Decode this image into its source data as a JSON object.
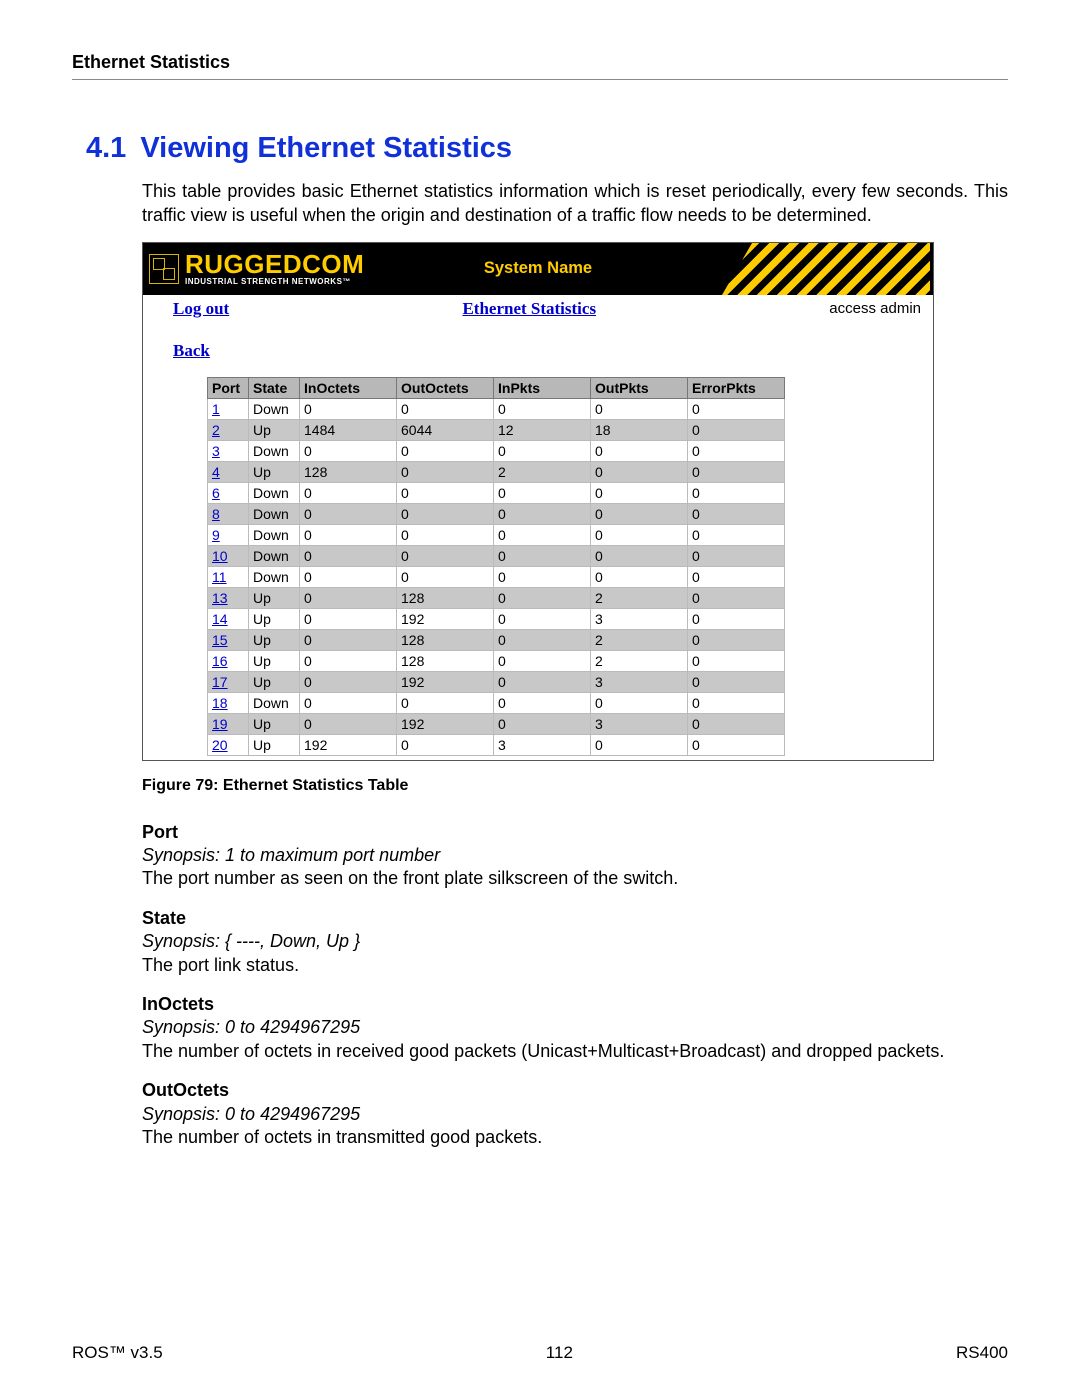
{
  "header": {
    "title": "Ethernet Statistics"
  },
  "section": {
    "number": "4.1",
    "title": "Viewing Ethernet Statistics",
    "paragraph": "This table provides basic Ethernet statistics information which is reset periodically, every few seconds. This traffic view is useful when the origin and destination of a traffic flow needs to be determined."
  },
  "screenshot": {
    "brand": "RUGGEDCOM",
    "brand_sub": "INDUSTRIAL STRENGTH NETWORKS™",
    "system_name": "System Name",
    "logout": "Log out",
    "page_title": "Ethernet Statistics",
    "access": "access admin",
    "back": "Back",
    "columns": [
      "Port",
      "State",
      "InOctets",
      "OutOctets",
      "InPkts",
      "OutPkts",
      "ErrorPkts"
    ],
    "rows": [
      {
        "port": "1",
        "state": "Down",
        "in_octets": "0",
        "out_octets": "0",
        "in_pkts": "0",
        "out_pkts": "0",
        "err": "0"
      },
      {
        "port": "2",
        "state": "Up",
        "in_octets": "1484",
        "out_octets": "6044",
        "in_pkts": "12",
        "out_pkts": "18",
        "err": "0"
      },
      {
        "port": "3",
        "state": "Down",
        "in_octets": "0",
        "out_octets": "0",
        "in_pkts": "0",
        "out_pkts": "0",
        "err": "0"
      },
      {
        "port": "4",
        "state": "Up",
        "in_octets": "128",
        "out_octets": "0",
        "in_pkts": "2",
        "out_pkts": "0",
        "err": "0"
      },
      {
        "port": "6",
        "state": "Down",
        "in_octets": "0",
        "out_octets": "0",
        "in_pkts": "0",
        "out_pkts": "0",
        "err": "0"
      },
      {
        "port": "8",
        "state": "Down",
        "in_octets": "0",
        "out_octets": "0",
        "in_pkts": "0",
        "out_pkts": "0",
        "err": "0"
      },
      {
        "port": "9",
        "state": "Down",
        "in_octets": "0",
        "out_octets": "0",
        "in_pkts": "0",
        "out_pkts": "0",
        "err": "0"
      },
      {
        "port": "10",
        "state": "Down",
        "in_octets": "0",
        "out_octets": "0",
        "in_pkts": "0",
        "out_pkts": "0",
        "err": "0"
      },
      {
        "port": "11",
        "state": "Down",
        "in_octets": "0",
        "out_octets": "0",
        "in_pkts": "0",
        "out_pkts": "0",
        "err": "0"
      },
      {
        "port": "13",
        "state": "Up",
        "in_octets": "0",
        "out_octets": "128",
        "in_pkts": "0",
        "out_pkts": "2",
        "err": "0"
      },
      {
        "port": "14",
        "state": "Up",
        "in_octets": "0",
        "out_octets": "192",
        "in_pkts": "0",
        "out_pkts": "3",
        "err": "0"
      },
      {
        "port": "15",
        "state": "Up",
        "in_octets": "0",
        "out_octets": "128",
        "in_pkts": "0",
        "out_pkts": "2",
        "err": "0"
      },
      {
        "port": "16",
        "state": "Up",
        "in_octets": "0",
        "out_octets": "128",
        "in_pkts": "0",
        "out_pkts": "2",
        "err": "0"
      },
      {
        "port": "17",
        "state": "Up",
        "in_octets": "0",
        "out_octets": "192",
        "in_pkts": "0",
        "out_pkts": "3",
        "err": "0"
      },
      {
        "port": "18",
        "state": "Down",
        "in_octets": "0",
        "out_octets": "0",
        "in_pkts": "0",
        "out_pkts": "0",
        "err": "0"
      },
      {
        "port": "19",
        "state": "Up",
        "in_octets": "0",
        "out_octets": "192",
        "in_pkts": "0",
        "out_pkts": "3",
        "err": "0"
      },
      {
        "port": "20",
        "state": "Up",
        "in_octets": "192",
        "out_octets": "0",
        "in_pkts": "3",
        "out_pkts": "0",
        "err": "0"
      }
    ]
  },
  "figure_caption": "Figure 79: Ethernet Statistics Table",
  "fields": [
    {
      "title": "Port",
      "synopsis": "Synopsis: 1 to maximum port number",
      "desc": "The port number as seen on the front plate silkscreen of the switch."
    },
    {
      "title": "State",
      "synopsis": "Synopsis: { ----, Down, Up }",
      "desc": "The port link status."
    },
    {
      "title": "InOctets",
      "synopsis": "Synopsis: 0 to 4294967295",
      "desc": "The number of octets in received good packets (Unicast+Multicast+Broadcast) and dropped packets."
    },
    {
      "title": "OutOctets",
      "synopsis": "Synopsis: 0 to 4294967295",
      "desc": "The number of octets in transmitted good packets."
    }
  ],
  "footer": {
    "left": "ROS™  v3.5",
    "center": "112",
    "right": "RS400"
  }
}
